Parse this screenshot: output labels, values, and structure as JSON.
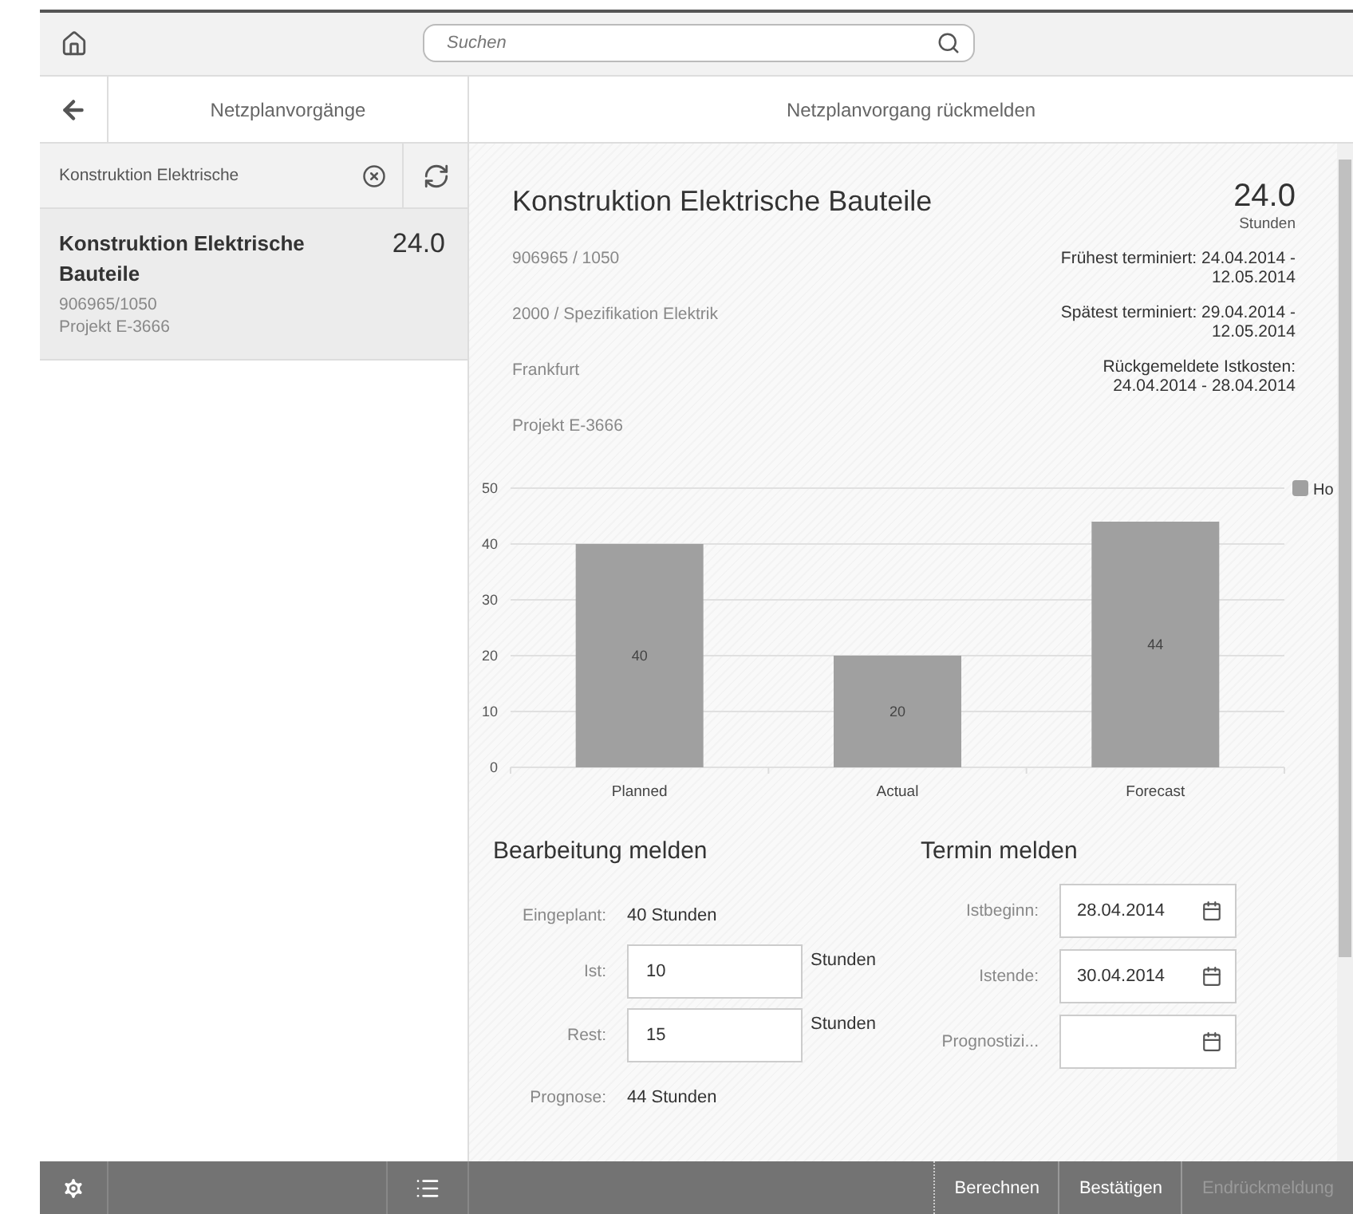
{
  "top_bar": {
    "search": {
      "placeholder": "Suchen"
    }
  },
  "master": {
    "title": "Netzplanvorgänge",
    "filter": {
      "value": "Konstruktion Elektrische"
    },
    "items": [
      {
        "title": "Konstruktion Elektrische Bauteile",
        "number": "24.0",
        "id_line": "906965/1050",
        "project": "Projekt E-3666",
        "selected": true
      }
    ]
  },
  "detail": {
    "title": "Netzplanvorgang rückmelden",
    "header": {
      "title": "Konstruktion Elektrische Bauteile",
      "number": "24.0",
      "unit": "Stunden"
    },
    "attributes": [
      "906965 / 1050",
      "2000 / Spezifikation Elektrik",
      "Frankfurt",
      "Projekt E-3666"
    ],
    "statuses": [
      {
        "label": "Frühest terminiert:",
        "value": "24.04.2014 - 12.05.2014"
      },
      {
        "label": "Spätest terminiert:",
        "value": "29.04.2014 - 12.05.2014"
      },
      {
        "label": "Rückgemeldete Istkosten:",
        "value": "24.04.2014 - 28.04.2014"
      }
    ],
    "chart_data": {
      "type": "bar",
      "categories": [
        "Planned",
        "Actual",
        "Forecast"
      ],
      "series": [
        {
          "name": "Ho",
          "color": "#a0a0a0",
          "values": [
            40,
            20,
            44
          ]
        }
      ],
      "ylim": [
        0,
        50
      ],
      "grid": true,
      "yticks": [
        0,
        10,
        20,
        30,
        40,
        50
      ],
      "data_labels": true
    },
    "work": {
      "title": "Bearbeitung melden",
      "rows": [
        {
          "kind": "text",
          "label": "Eingeplant:",
          "value": "40 Stunden"
        },
        {
          "kind": "input",
          "label": "Ist:",
          "value": "10",
          "unit": "Stunden"
        },
        {
          "kind": "input",
          "label": "Rest:",
          "value": "15",
          "unit": "Stunden"
        },
        {
          "kind": "text",
          "label": "Prognose:",
          "value": "44 Stunden"
        }
      ]
    },
    "dates": {
      "title": "Termin melden",
      "rows": [
        {
          "label": "Istbeginn:",
          "value": "28.04.2014"
        },
        {
          "label": "Istende:",
          "value": "30.04.2014"
        },
        {
          "label": "Prognostizi..."
        }
      ]
    }
  },
  "footer": {
    "buttons": [
      {
        "label": "Berechnen",
        "disabled": false
      },
      {
        "label": "Bestätigen",
        "disabled": false
      },
      {
        "label": "Endrückmeldung",
        "disabled": true
      }
    ]
  }
}
